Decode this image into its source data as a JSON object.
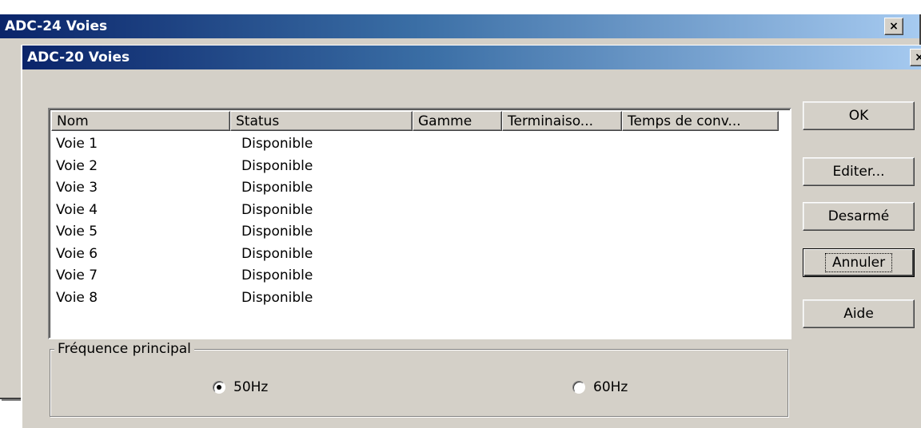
{
  "back_window": {
    "title": "ADC-24 Voies",
    "close": "×"
  },
  "front_window": {
    "title": "ADC-20 Voies",
    "close": "×"
  },
  "list": {
    "columns": [
      "Nom",
      "Status",
      "Gamme",
      "Terminaiso...",
      "Temps de conv..."
    ],
    "rows": [
      {
        "nom": "Voie 1",
        "status": "Disponible"
      },
      {
        "nom": "Voie 2",
        "status": "Disponible"
      },
      {
        "nom": "Voie 3",
        "status": "Disponible"
      },
      {
        "nom": "Voie 4",
        "status": "Disponible"
      },
      {
        "nom": "Voie 5",
        "status": "Disponible"
      },
      {
        "nom": "Voie 6",
        "status": "Disponible"
      },
      {
        "nom": "Voie 7",
        "status": "Disponible"
      },
      {
        "nom": "Voie 8",
        "status": "Disponible"
      }
    ]
  },
  "buttons": {
    "ok": "OK",
    "editer": "Editer...",
    "desarme": "Desarmé",
    "annuler": "Annuler",
    "aide": "Aide"
  },
  "frequence": {
    "title": "Fréquence principal",
    "options": [
      {
        "label": "50Hz",
        "selected": true
      },
      {
        "label": "60Hz",
        "selected": false
      }
    ]
  }
}
